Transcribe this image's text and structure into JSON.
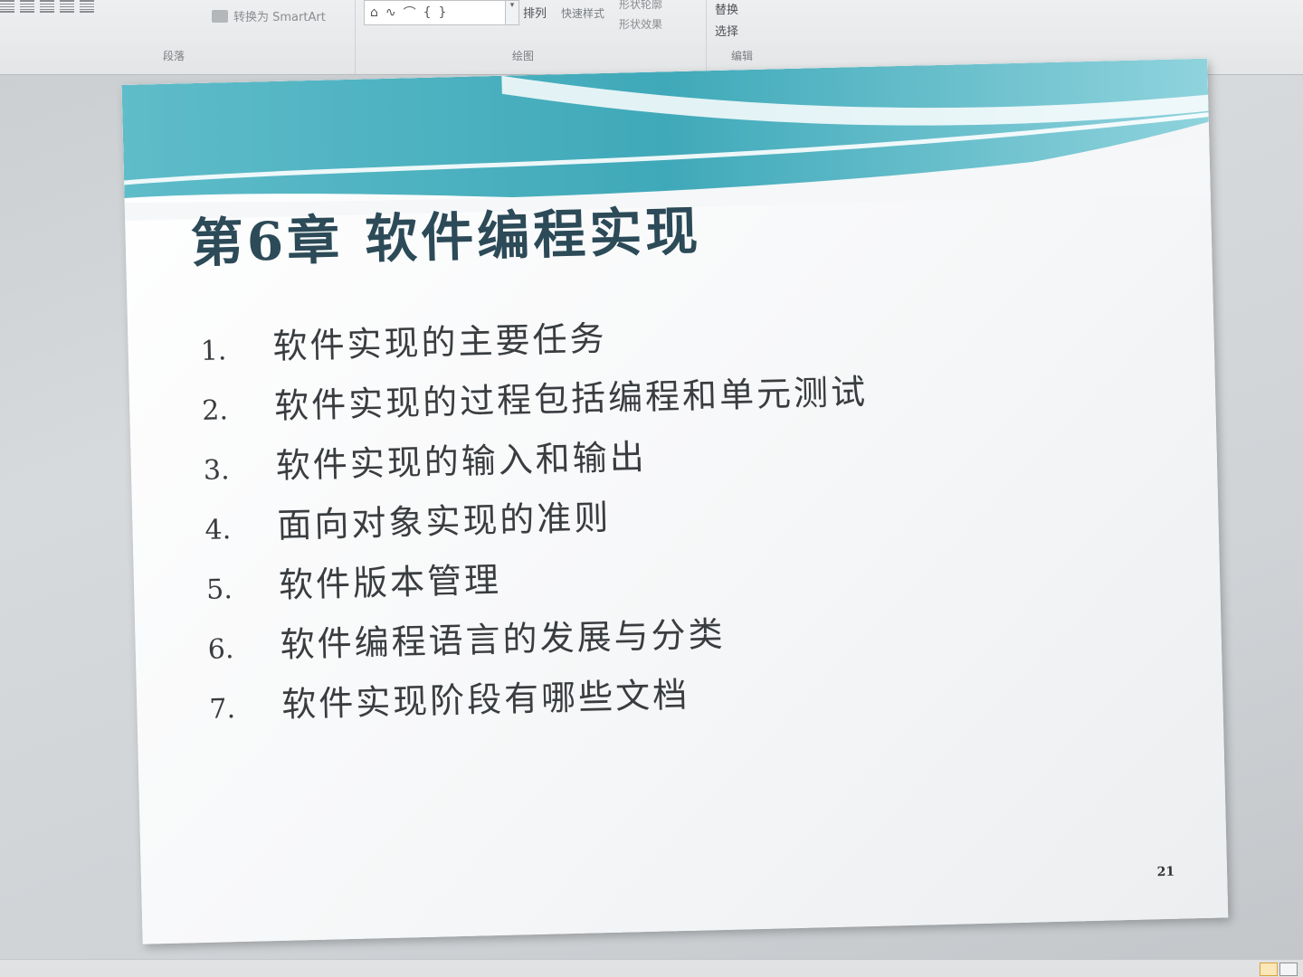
{
  "ribbon": {
    "paragraph_group": {
      "label": "段落",
      "smartart_label": "转换为 SmartArt"
    },
    "drawing_group": {
      "label": "绘图",
      "arrange_label": "排列",
      "quick_styles_label": "快速样式",
      "shape_outline_label": "形状轮廓",
      "shape_effects_label": "形状效果"
    },
    "editing_group": {
      "label": "编辑",
      "replace_label": "替换",
      "select_label": "选择"
    }
  },
  "slide": {
    "title": "第6章 软件编程实现",
    "items": [
      {
        "num": "1.",
        "text": "软件实现的主要任务"
      },
      {
        "num": "2.",
        "text": "软件实现的过程包括编程和单元测试"
      },
      {
        "num": "3.",
        "text": "软件实现的输入和输出"
      },
      {
        "num": "4.",
        "text": "面向对象实现的准则"
      },
      {
        "num": "5.",
        "text": "软件版本管理"
      },
      {
        "num": "6.",
        "text": "软件编程语言的发展与分类"
      },
      {
        "num": "7.",
        "text": "软件实现阶段有哪些文档"
      }
    ],
    "page_number": "21"
  },
  "colors": {
    "title": "#2c4a57",
    "header_teal": "#3fa9b9",
    "body_text": "#3a3d40"
  }
}
